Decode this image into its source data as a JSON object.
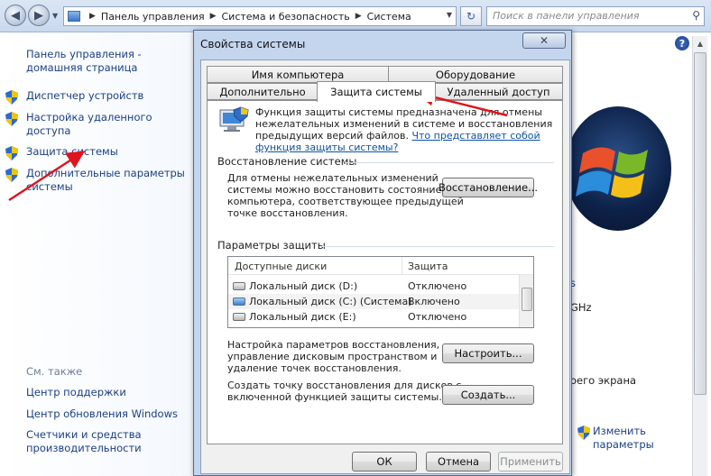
{
  "toolbar": {
    "breadcrumb": [
      "Панель управления",
      "Система и безопасность",
      "Система"
    ],
    "search_placeholder": "Поиск в панели управления"
  },
  "left": {
    "home": [
      "Панель управления -",
      "домашняя страница"
    ],
    "links": [
      {
        "label": [
          "Диспетчер устройств"
        ],
        "icon": "shield-icon"
      },
      {
        "label": [
          "Настройка удаленного",
          "доступа"
        ],
        "icon": "shield-icon"
      },
      {
        "label": [
          "Защита системы"
        ],
        "icon": "shield-icon"
      },
      {
        "label": [
          "Дополнительные параметры",
          "системы"
        ],
        "icon": "shield-icon"
      }
    ],
    "see_also": "См. также",
    "see_links": [
      "Центр поддержки",
      "Центр обновления Windows",
      "Счетчики и средства",
      "производительности"
    ]
  },
  "right": {
    "partial": [
      "s",
      "GHz",
      "оего экрана"
    ],
    "change_params": [
      "Изменить",
      "параметры"
    ]
  },
  "dialog": {
    "title": "Свойства системы",
    "close": "✕",
    "tabs_top": [
      "Имя компьютера",
      "Оборудование"
    ],
    "tabs_bottom": [
      "Дополнительно",
      "Защита системы",
      "Удаленный доступ"
    ],
    "intro": [
      "Функция защиты системы предназначена для отмены",
      "нежелательных изменений в системе и восстановления",
      "предыдущих версий файлов."
    ],
    "intro_link": [
      "Что представляет собой",
      "функция защиты системы?"
    ],
    "restore_heading": "Восстановление системы",
    "restore_text": [
      "Для отмены нежелательных изменений",
      "системы можно восстановить состояние",
      "компьютера, соответствующее предыдущей",
      "точке восстановления."
    ],
    "restore_btn": "Восстановление...",
    "protect_heading": "Параметры защиты",
    "list_cols": [
      "Доступные диски",
      "Защита"
    ],
    "drives": [
      {
        "name": "Локальный диск (D:)",
        "status": "Отключено"
      },
      {
        "name": "Локальный диск (C:) (Система)",
        "status": "Включено"
      },
      {
        "name": "Локальный диск (E:)",
        "status": "Отключено"
      }
    ],
    "config_text": [
      "Настройка параметров восстановления,",
      "управление дисковым пространством и",
      "удаление точек восстановления."
    ],
    "config_btn": "Настроить...",
    "create_text": [
      "Создать точку восстановления для дисков с",
      "включенной функцией защиты системы."
    ],
    "create_btn": "Создать...",
    "ok": "ОК",
    "cancel": "Отмена",
    "apply": "Применить"
  },
  "colors": {
    "arrow": "#e0141e",
    "link": "#1b3f86"
  }
}
